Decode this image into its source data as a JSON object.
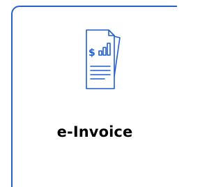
{
  "card": {
    "label": "e-Invoice",
    "icon": "invoice-document-icon",
    "accent_color": "#2363c9",
    "icon_color": "#1f5fd0"
  }
}
